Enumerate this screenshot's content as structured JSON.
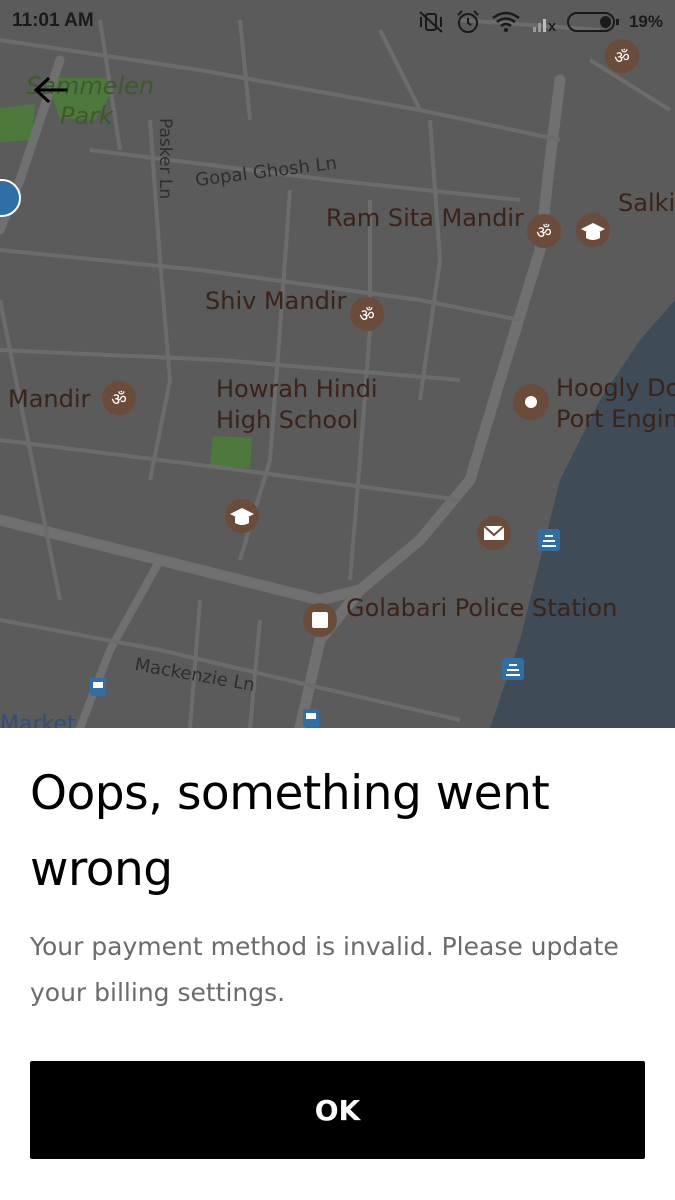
{
  "status_bar": {
    "time": "11:01 AM",
    "battery_percent": "19%",
    "icons": [
      "vibrate-off-icon",
      "alarm-icon",
      "wifi-icon",
      "signal-icon",
      "battery-icon"
    ]
  },
  "map": {
    "labels": {
      "sammelen_park": "Sammelen\nPark",
      "pasker_ln": "Pasker Ln",
      "gopal_ghosh_ln": "Gopal Ghosh Ln",
      "ram_sita_mandir": "Ram Sita Mandir",
      "salki": "Salki",
      "shiv_mandir": "Shiv Mandir",
      "mandir_left": "Mandir",
      "howrah_hindi_1": "Howrah Hindi",
      "howrah_hindi_2": "High School",
      "hoogly_1": "Hoogly Do",
      "hoogly_2": "Port Engin",
      "golabari": "Golabari Police Station",
      "mackenzie": "Mackenzie Ln",
      "market": "Market"
    },
    "colors": {
      "land": "#5b5b5b",
      "road": "#6e6e6e",
      "water": "#3f4b57",
      "park": "#4d7a3c",
      "poi": "#6b4b3a",
      "label": "#3a2318"
    }
  },
  "dialog": {
    "title": "Oops, something went wrong",
    "message": "Your payment method is invalid. Please update your billing settings.",
    "ok_label": "OK"
  }
}
